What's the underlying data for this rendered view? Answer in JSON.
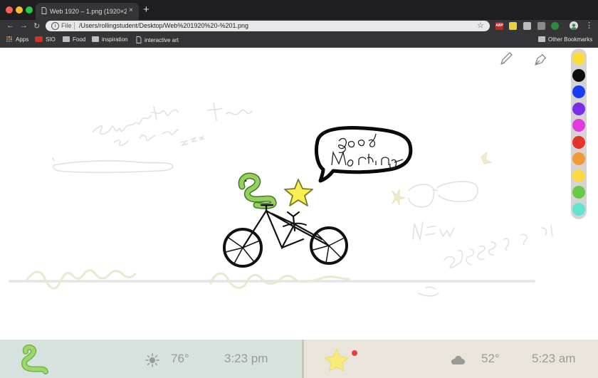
{
  "browser": {
    "tab_title": "Web 1920 – 1.png (1920×2581)",
    "tab_close": "×",
    "new_tab": "+",
    "nav": {
      "back": "←",
      "forward": "→",
      "reload": "↻"
    },
    "omnibox": {
      "info": "i",
      "scheme": "File",
      "url": "/Users/rollingstudent/Desktop/Web%201920%20-%201.png",
      "bookmark_star": "☆"
    },
    "extensions": [
      {
        "name": "ABP",
        "label": "ABP",
        "color": "#c42424"
      },
      {
        "name": "notes",
        "label": "",
        "color": "#e8d23a"
      },
      {
        "name": "photo",
        "label": "",
        "color": "#bdbdbd"
      },
      {
        "name": "download",
        "label": "",
        "color": "#8a8a8a"
      },
      {
        "name": "shield",
        "label": "",
        "color": "#2d8a3f"
      }
    ],
    "menu": "⋮",
    "bookmarks": [
      {
        "label": "Apps",
        "icon": "grid-icon"
      },
      {
        "label": "SIO",
        "icon": "sio-icon"
      },
      {
        "label": "Food",
        "icon": "folder-icon"
      },
      {
        "label": "inspiration",
        "icon": "folder-icon"
      },
      {
        "label": "interactive art",
        "icon": "page-icon"
      }
    ],
    "other_bookmarks": "Other Bookmarks"
  },
  "canvas": {
    "speech_bubble_text": "Good Morning",
    "sketches": {
      "sleeping": "sleep'n all day today zzz",
      "new_glasses": "NEW GLASSES!"
    },
    "tools": [
      "pencil-icon",
      "pen-nib-icon"
    ]
  },
  "palette": {
    "colors": [
      "#fddb3b",
      "#0d0d0d",
      "#1b3df0",
      "#7a2ee8",
      "#e23adf",
      "#e2352c",
      "#f19a37",
      "#fbd93f",
      "#6bc94a",
      "#62e4cf"
    ]
  },
  "footer": {
    "left": {
      "temperature": "76°",
      "time": "3:23 pm",
      "weather_icon": "sun-icon",
      "avatar_icon": "snake-icon",
      "bg": "#d6e2dd"
    },
    "right": {
      "temperature": "52°",
      "time": "5:23 am",
      "weather_icon": "cloud-icon",
      "avatar_icon": "star-icon",
      "bg": "#e9e5db",
      "has_notification": true
    }
  }
}
